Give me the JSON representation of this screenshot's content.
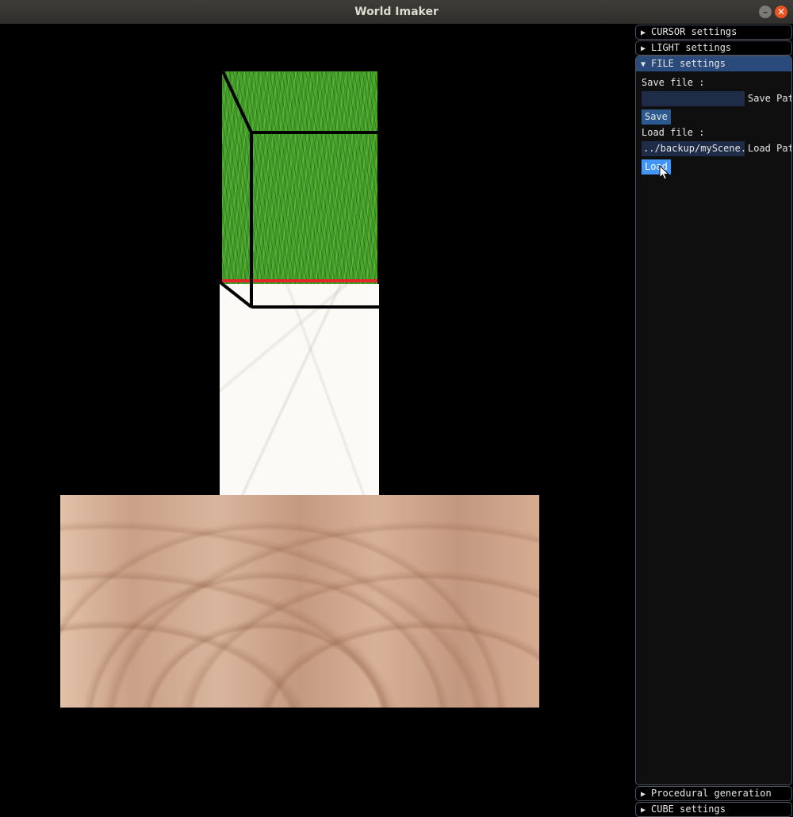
{
  "window": {
    "title": "World Imaker"
  },
  "panels": {
    "cursor": {
      "label": "CURSOR settings"
    },
    "light": {
      "label": "LIGHT settings"
    },
    "file": {
      "label": "FILE settings",
      "save_label": "Save file :",
      "save_input_value": "",
      "save_path_label": "Save Path",
      "save_button": "Save",
      "load_label": "Load file :",
      "load_input_value": "../backup/myScene.",
      "load_path_label": "Load Path",
      "load_button": "Load"
    },
    "procedural": {
      "label": "Procedural generation"
    },
    "cube": {
      "label": "CUBE settings"
    }
  },
  "icons": {
    "collapsed": "triangle-right",
    "expanded": "triangle-down"
  },
  "colors": {
    "panel_header_active": "#294a7a",
    "button": "#2c5a8e",
    "button_active": "#4296fa",
    "input_bg": "#1e2c47",
    "highlight_edge": "#e0282b"
  }
}
